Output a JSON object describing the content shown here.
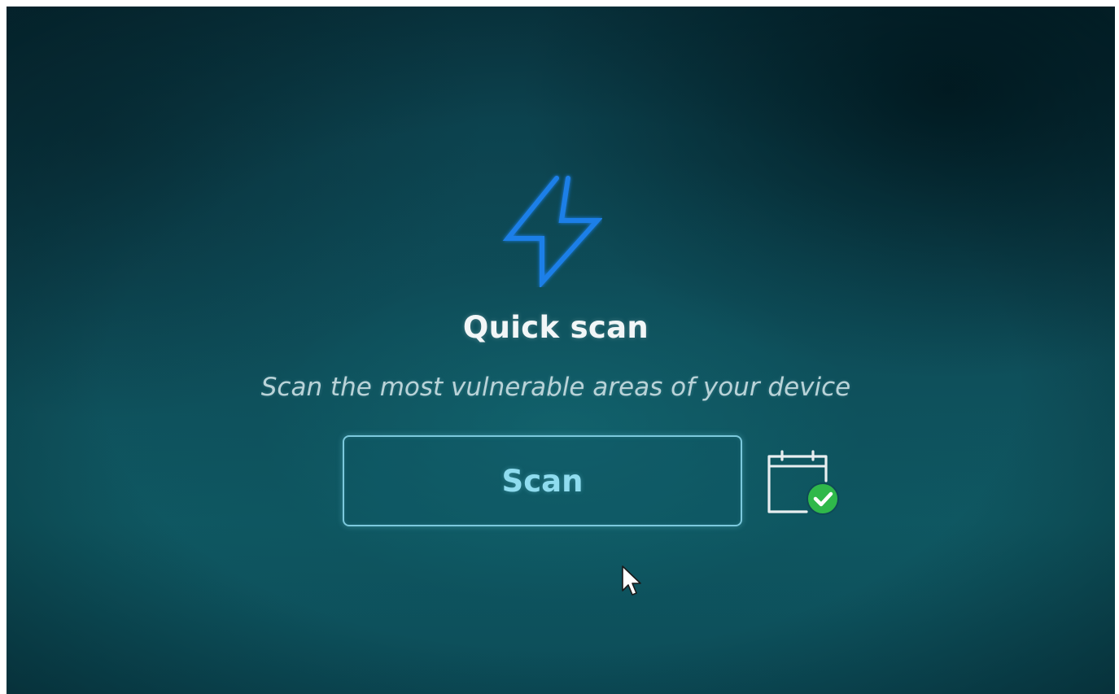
{
  "scan_panel": {
    "title": "Quick scan",
    "description": "Scan the most vulnerable areas of your device",
    "button_label": "Scan"
  },
  "icons": {
    "main": "lightning-bolt-icon",
    "schedule": "calendar-check-icon",
    "pointer": "mouse-cursor-icon"
  },
  "colors": {
    "accent_blue": "#1f7fe8",
    "button_border": "#7cc9dd",
    "button_text": "#8fdcef",
    "check_green": "#2fb84a",
    "background": "#0e4a56"
  }
}
